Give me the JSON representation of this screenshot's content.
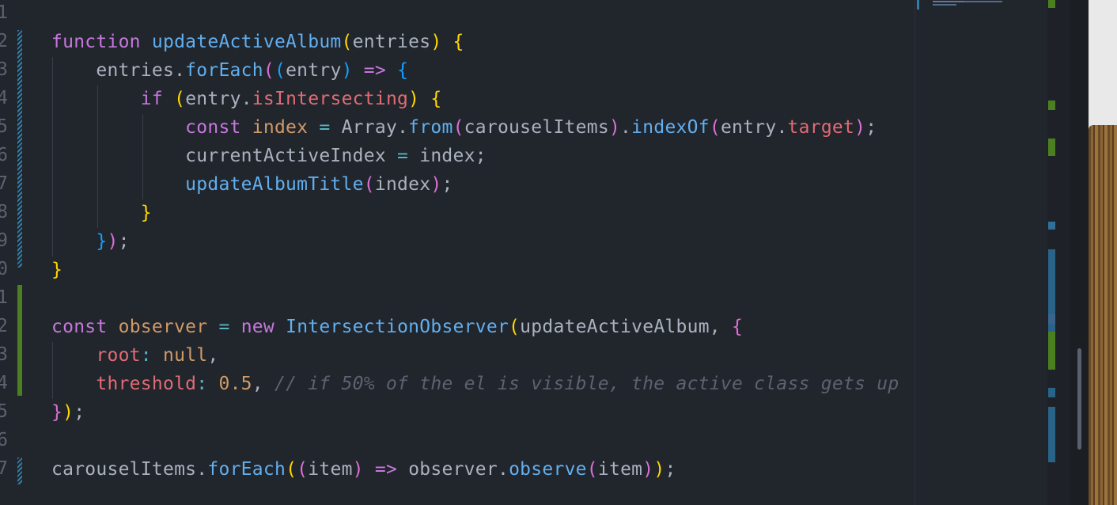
{
  "editor": {
    "lines": [
      {
        "n": "1",
        "tokens": []
      },
      {
        "n": "2",
        "tokens": [
          [
            "k",
            "function "
          ],
          [
            "f",
            "updateActiveAlbum"
          ],
          [
            "b1",
            "("
          ],
          [
            "v",
            "entries"
          ],
          [
            "b1",
            ")"
          ],
          [
            "v",
            " "
          ],
          [
            "b1",
            "{"
          ]
        ]
      },
      {
        "n": "3",
        "tokens": [
          [
            "v",
            "    entries."
          ],
          [
            "f",
            "forEach"
          ],
          [
            "b2",
            "("
          ],
          [
            "b3",
            "("
          ],
          [
            "v",
            "entry"
          ],
          [
            "b3",
            ")"
          ],
          [
            "v",
            " "
          ],
          [
            "k",
            "=>"
          ],
          [
            "v",
            " "
          ],
          [
            "b3",
            "{"
          ]
        ]
      },
      {
        "n": "4",
        "tokens": [
          [
            "v",
            "        "
          ],
          [
            "k",
            "if"
          ],
          [
            "v",
            " "
          ],
          [
            "b1",
            "("
          ],
          [
            "v",
            "entry."
          ],
          [
            "prop",
            "isIntersecting"
          ],
          [
            "b1",
            ")"
          ],
          [
            "v",
            " "
          ],
          [
            "b1",
            "{"
          ]
        ]
      },
      {
        "n": "5",
        "tokens": [
          [
            "v",
            "            "
          ],
          [
            "k",
            "const "
          ],
          [
            "num",
            "index"
          ],
          [
            "v",
            " "
          ],
          [
            "o",
            "="
          ],
          [
            "v",
            " Array."
          ],
          [
            "f",
            "from"
          ],
          [
            "b2",
            "("
          ],
          [
            "v",
            "carouselItems"
          ],
          [
            "b2",
            ")"
          ],
          [
            "v",
            "."
          ],
          [
            "f",
            "indexOf"
          ],
          [
            "b2",
            "("
          ],
          [
            "v",
            "entry."
          ],
          [
            "prop",
            "target"
          ],
          [
            "b2",
            ")"
          ],
          [
            "v",
            ";"
          ]
        ]
      },
      {
        "n": "6",
        "tokens": [
          [
            "v",
            "            currentActiveIndex "
          ],
          [
            "o",
            "="
          ],
          [
            "v",
            " index;"
          ]
        ]
      },
      {
        "n": "7",
        "tokens": [
          [
            "v",
            "            "
          ],
          [
            "f",
            "updateAlbumTitle"
          ],
          [
            "b2",
            "("
          ],
          [
            "v",
            "index"
          ],
          [
            "b2",
            ")"
          ],
          [
            "v",
            ";"
          ]
        ]
      },
      {
        "n": "8",
        "tokens": [
          [
            "v",
            "        "
          ],
          [
            "b1",
            "}"
          ]
        ]
      },
      {
        "n": "9",
        "tokens": [
          [
            "v",
            "    "
          ],
          [
            "b3",
            "}"
          ],
          [
            "b2",
            ")"
          ],
          [
            "v",
            ";"
          ]
        ]
      },
      {
        "n": "0",
        "tokens": [
          [
            "b1",
            "}"
          ]
        ]
      },
      {
        "n": "1",
        "tokens": []
      },
      {
        "n": "2",
        "tokens": [
          [
            "k",
            "const "
          ],
          [
            "num",
            "observer"
          ],
          [
            "v",
            " "
          ],
          [
            "o",
            "="
          ],
          [
            "v",
            " "
          ],
          [
            "k",
            "new "
          ],
          [
            "cl",
            "IntersectionObserver"
          ],
          [
            "b1",
            "("
          ],
          [
            "v",
            "updateActiveAlbum, "
          ],
          [
            "b2",
            "{"
          ]
        ]
      },
      {
        "n": "3",
        "tokens": [
          [
            "v",
            "    "
          ],
          [
            "prop",
            "root"
          ],
          [
            "o",
            ":"
          ],
          [
            "v",
            " "
          ],
          [
            "num",
            "null"
          ],
          [
            "v",
            ","
          ]
        ]
      },
      {
        "n": "4",
        "tokens": [
          [
            "v",
            "    "
          ],
          [
            "prop",
            "threshold"
          ],
          [
            "o",
            ":"
          ],
          [
            "v",
            " "
          ],
          [
            "num",
            "0.5"
          ],
          [
            "v",
            ", "
          ],
          [
            "cm",
            "// if 50% of the el is visible, the active class gets up"
          ]
        ]
      },
      {
        "n": "5",
        "tokens": [
          [
            "b2",
            "}"
          ],
          [
            "b1",
            ")"
          ],
          [
            "v",
            ";"
          ]
        ]
      },
      {
        "n": "6",
        "tokens": []
      },
      {
        "n": "7",
        "tokens": [
          [
            "v",
            "carouselItems."
          ],
          [
            "f",
            "forEach"
          ],
          [
            "b1",
            "("
          ],
          [
            "b2",
            "("
          ],
          [
            "v",
            "item"
          ],
          [
            "b2",
            ")"
          ],
          [
            "v",
            " "
          ],
          [
            "k",
            "=>"
          ],
          [
            "v",
            " observer."
          ],
          [
            "f",
            "observe"
          ],
          [
            "b2",
            "("
          ],
          [
            "v",
            "item"
          ],
          [
            "b2",
            ")"
          ],
          [
            "b1",
            ")"
          ],
          [
            "v",
            ";"
          ]
        ]
      }
    ]
  },
  "colors": {
    "background": "#21252c",
    "keyword": "#c678dd",
    "function": "#61afef",
    "property": "#e06c75",
    "number": "#d19a66",
    "comment": "#5c6370",
    "git_modified": "#2f7fa8",
    "git_added": "#4b7f1f"
  }
}
